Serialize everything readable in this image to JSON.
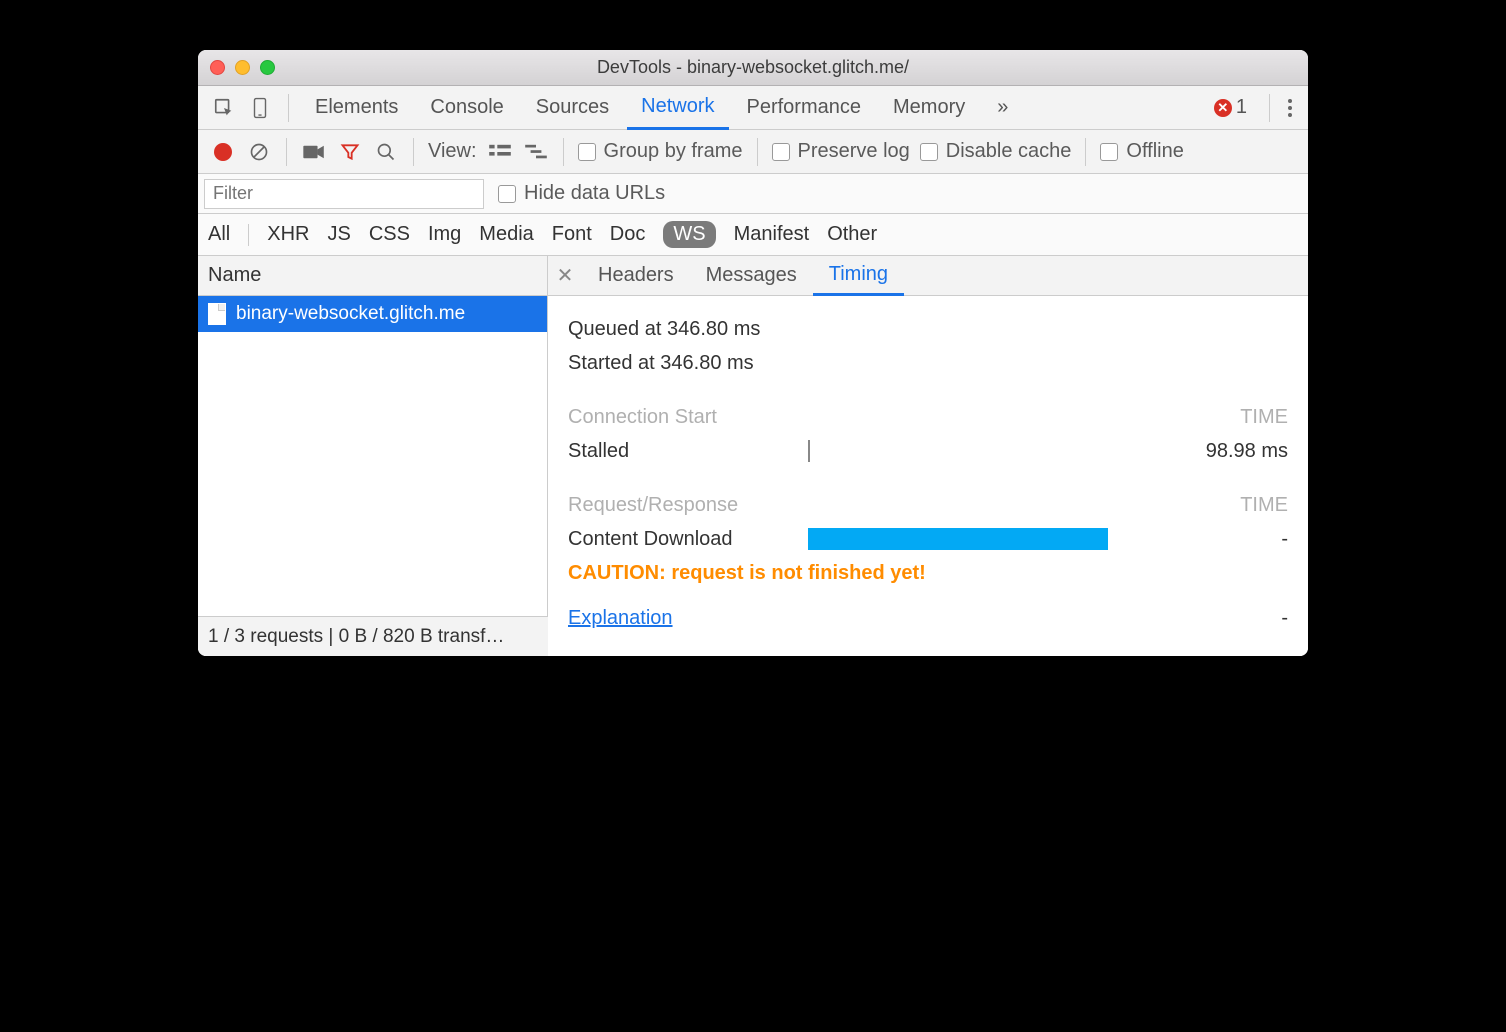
{
  "window": {
    "title": "DevTools - binary-websocket.glitch.me/"
  },
  "tabs": {
    "items": [
      "Elements",
      "Console",
      "Sources",
      "Network",
      "Performance",
      "Memory"
    ],
    "active": "Network",
    "overflow": "»",
    "error_count": "1"
  },
  "toolbar": {
    "view_label": "View:",
    "group_by_frame": "Group by frame",
    "preserve_log": "Preserve log",
    "disable_cache": "Disable cache",
    "offline": "Offline"
  },
  "filter": {
    "placeholder": "Filter",
    "hide_data_urls": "Hide data URLs"
  },
  "types": {
    "items": [
      "All",
      "XHR",
      "JS",
      "CSS",
      "Img",
      "Media",
      "Font",
      "Doc",
      "WS",
      "Manifest",
      "Other"
    ],
    "selected": "WS"
  },
  "left": {
    "header": "Name",
    "rows": [
      "binary-websocket.glitch.me"
    ]
  },
  "detail": {
    "tabs": [
      "Headers",
      "Messages",
      "Timing"
    ],
    "active": "Timing"
  },
  "timing": {
    "queued": "Queued at 346.80 ms",
    "started": "Started at 346.80 ms",
    "connection_start": "Connection Start",
    "time_header": "TIME",
    "stalled_label": "Stalled",
    "stalled_time": "98.98 ms",
    "req_resp": "Request/Response",
    "content_download": "Content Download",
    "content_download_time": "-",
    "caution": "CAUTION: request is not finished yet!",
    "explanation": "Explanation",
    "explanation_time": "-"
  },
  "status": "1 / 3 requests | 0 B / 820 B transf…"
}
